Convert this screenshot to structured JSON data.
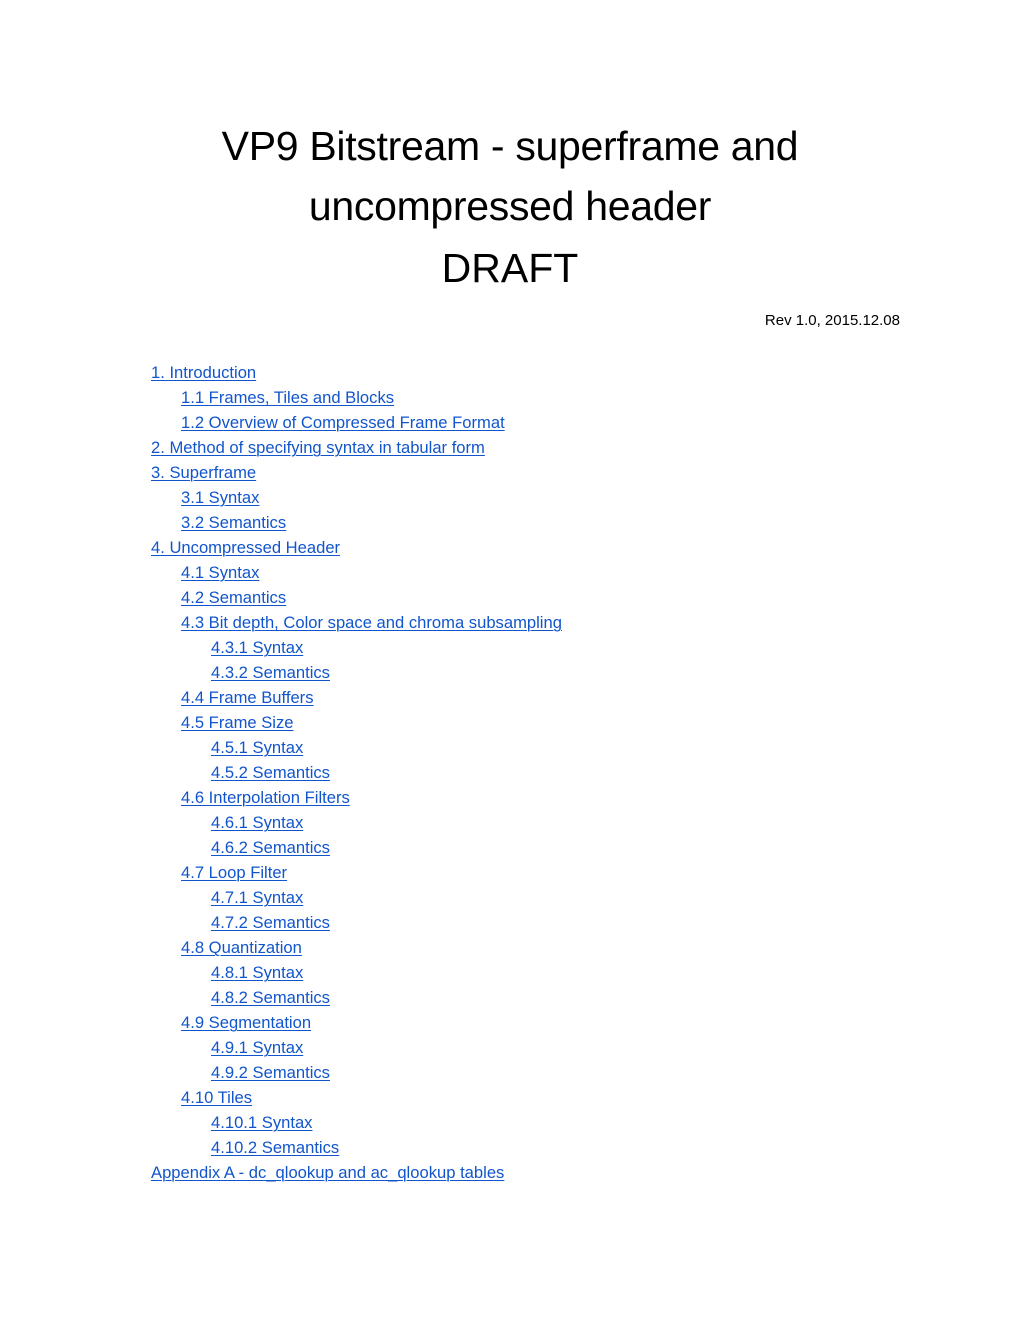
{
  "document": {
    "title_line_1": "VP9 Bitstream - superframe and",
    "title_line_2": "uncompressed header",
    "status": "DRAFT",
    "revision": "Rev 1.0, 2015.12.08",
    "link_color": "#1155cc"
  },
  "toc": {
    "entries": [
      {
        "label": "1. Introduction",
        "level": 0
      },
      {
        "label": "1.1 Frames, Tiles and Blocks",
        "level": 1
      },
      {
        "label": "1.2 Overview of Compressed Frame Format",
        "level": 1
      },
      {
        "label": "2. Method of specifying syntax in tabular form",
        "level": 0
      },
      {
        "label": "3. Superframe",
        "level": 0
      },
      {
        "label": "3.1 Syntax",
        "level": 1
      },
      {
        "label": "3.2 Semantics",
        "level": 1
      },
      {
        "label": "4. Uncompressed Header",
        "level": 0
      },
      {
        "label": "4.1 Syntax",
        "level": 1
      },
      {
        "label": "4.2 Semantics",
        "level": 1
      },
      {
        "label": "4.3 Bit depth, Color space and chroma subsampling",
        "level": 1
      },
      {
        "label": "4.3.1 Syntax",
        "level": 2
      },
      {
        "label": "4.3.2 Semantics",
        "level": 2
      },
      {
        "label": "4.4 Frame Buffers",
        "level": 1
      },
      {
        "label": "4.5 Frame Size",
        "level": 1
      },
      {
        "label": "4.5.1 Syntax",
        "level": 2
      },
      {
        "label": "4.5.2 Semantics",
        "level": 2
      },
      {
        "label": "4.6 Interpolation Filters",
        "level": 1
      },
      {
        "label": "4.6.1 Syntax",
        "level": 2
      },
      {
        "label": "4.6.2 Semantics",
        "level": 2
      },
      {
        "label": "4.7 Loop Filter",
        "level": 1
      },
      {
        "label": "4.7.1 Syntax",
        "level": 2
      },
      {
        "label": "4.7.2 Semantics",
        "level": 2
      },
      {
        "label": "4.8 Quantization",
        "level": 1
      },
      {
        "label": "4.8.1 Syntax",
        "level": 2
      },
      {
        "label": "4.8.2 Semantics",
        "level": 2
      },
      {
        "label": "4.9 Segmentation",
        "level": 1
      },
      {
        "label": "4.9.1 Syntax",
        "level": 2
      },
      {
        "label": "4.9.2 Semantics",
        "level": 2
      },
      {
        "label": "4.10 Tiles",
        "level": 1
      },
      {
        "label": "4.10.1 Syntax",
        "level": 2
      },
      {
        "label": "4.10.2 Semantics",
        "level": 2
      },
      {
        "label": "Appendix A - dc_qlookup and ac_qlookup tables",
        "level": 0
      }
    ]
  }
}
